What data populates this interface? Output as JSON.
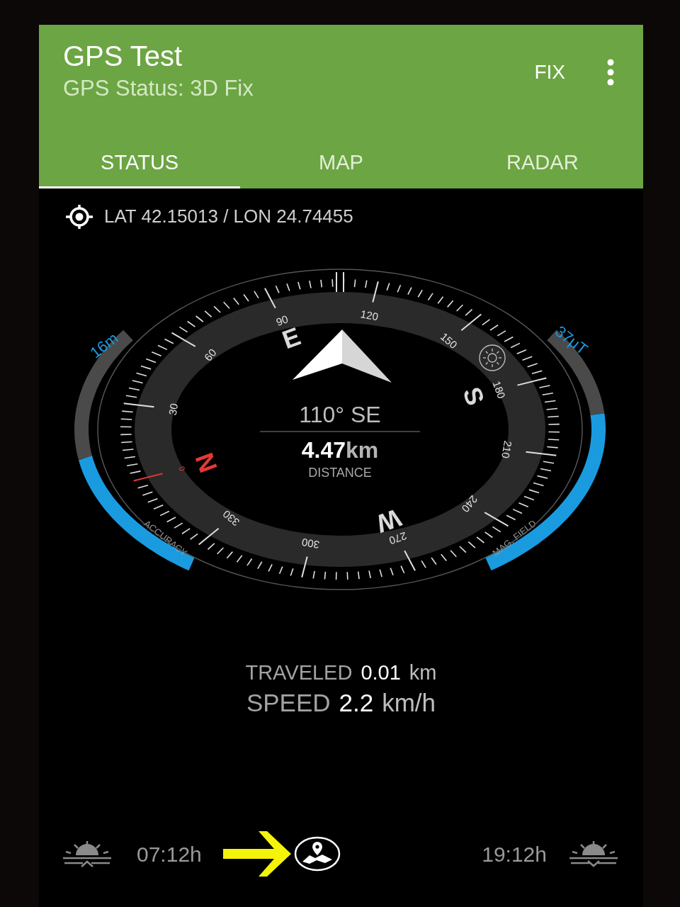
{
  "app_bar": {
    "title": "GPS Test",
    "subtitle": "GPS Status: 3D Fix",
    "action": "FIX"
  },
  "tabs": [
    {
      "label": "STATUS",
      "selected": true
    },
    {
      "label": "MAP",
      "selected": false
    },
    {
      "label": "RADAR",
      "selected": false
    }
  ],
  "coordinates": "LAT 42.15013 / LON 24.74455",
  "compass": {
    "heading": "110° SE",
    "distance_value": "4.47",
    "distance_unit": "km",
    "distance_label": "DISTANCE",
    "cardinals": [
      {
        "label": "N",
        "color": "#e53935"
      },
      {
        "label": "E",
        "color": "#d9d9d9"
      },
      {
        "label": "S",
        "color": "#d9d9d9"
      },
      {
        "label": "W",
        "color": "#d9d9d9"
      }
    ],
    "degrees": [
      "0",
      "30",
      "60",
      "90",
      "120",
      "150",
      "180",
      "210",
      "240",
      "270",
      "300",
      "330"
    ],
    "accuracy": {
      "reading": "16m",
      "label": "ACCURACY"
    },
    "mag_field": {
      "reading": "37μT",
      "label": "MAG. FIELD"
    }
  },
  "stats": [
    {
      "label": "TRAVELED",
      "value": "0.01",
      "unit": "km"
    },
    {
      "label": "SPEED",
      "value": "2.2",
      "unit": "km/h"
    }
  ],
  "sun": {
    "sunrise": "07:12h",
    "sunset": "19:12h"
  }
}
